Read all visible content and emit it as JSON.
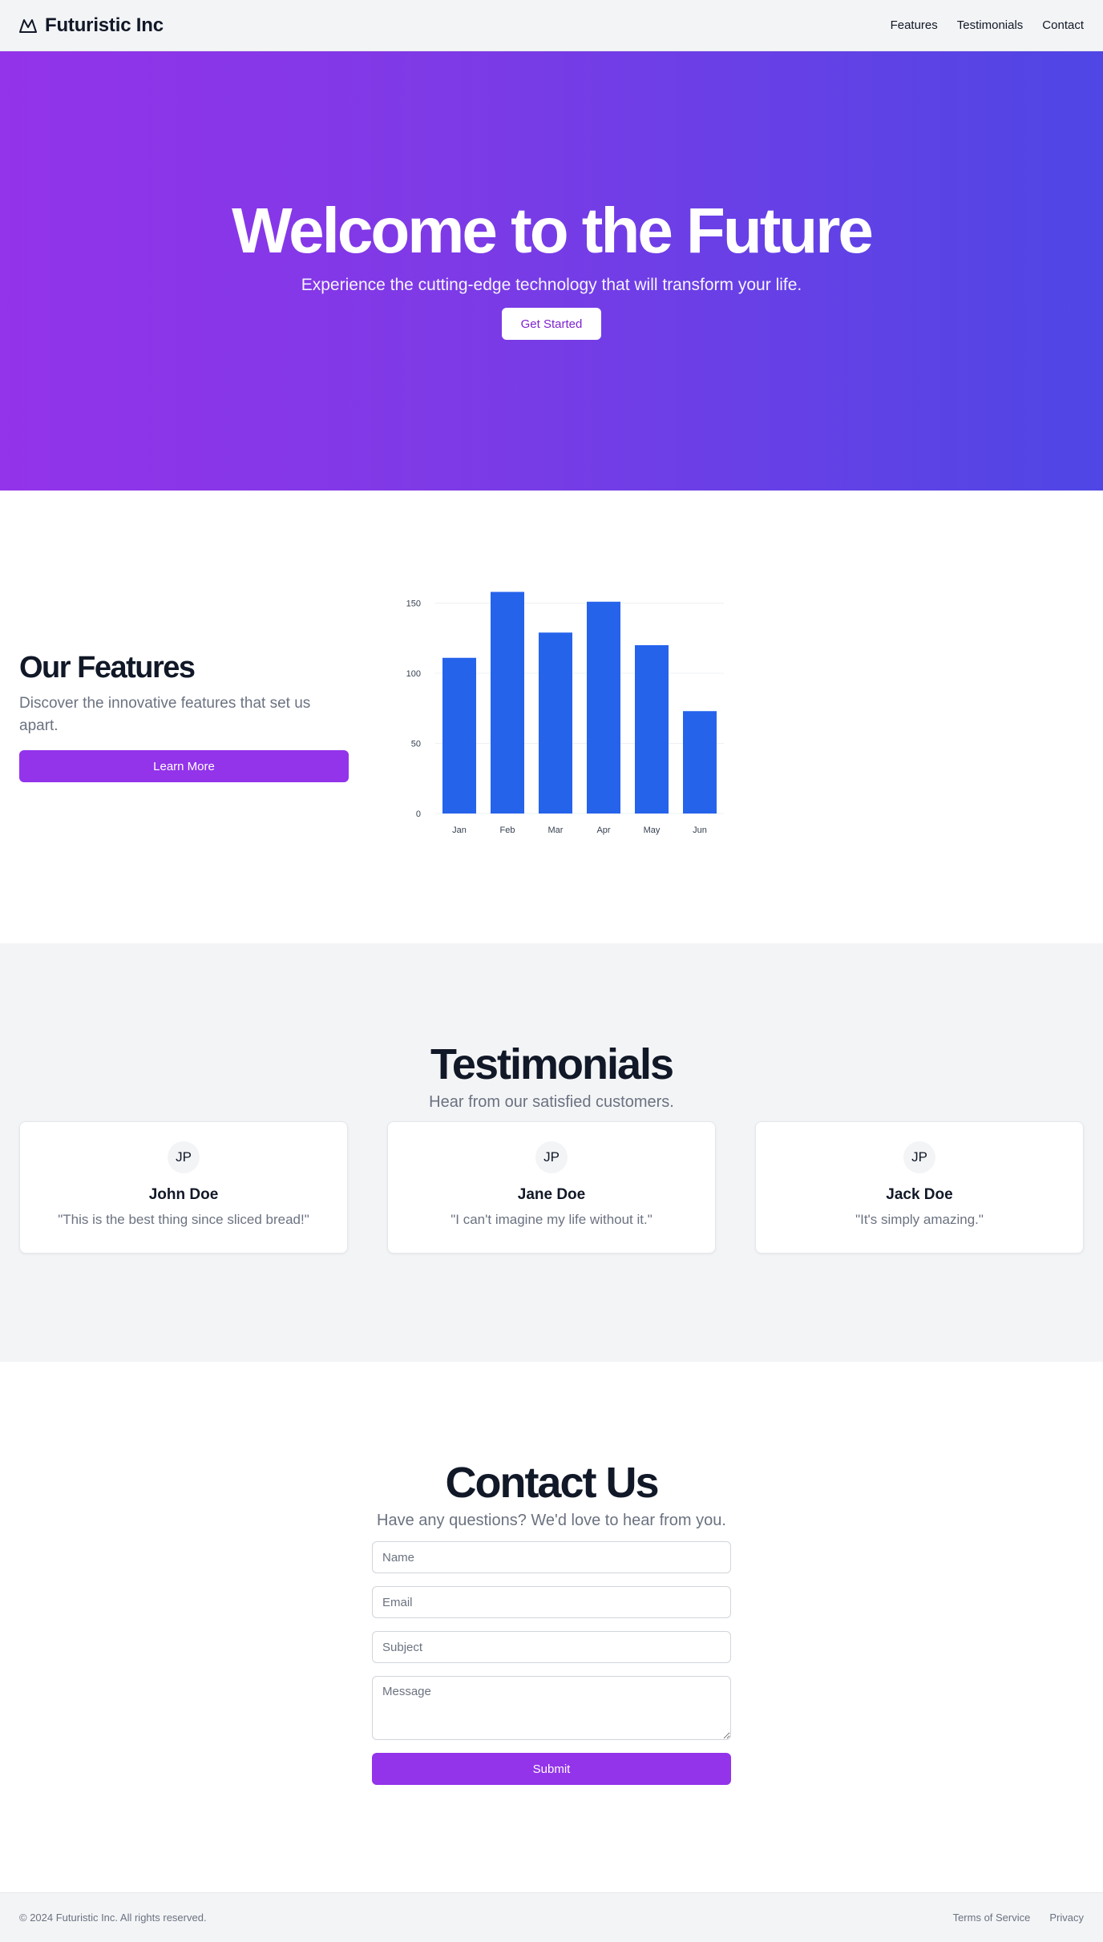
{
  "header": {
    "brand": "Futuristic Inc",
    "nav": [
      "Features",
      "Testimonials",
      "Contact"
    ]
  },
  "hero": {
    "title": "Welcome to the Future",
    "subtitle": "Experience the cutting-edge technology that will transform your life.",
    "cta": "Get Started"
  },
  "features": {
    "title": "Our Features",
    "text": "Discover the innovative features that set us apart.",
    "button": "Learn More"
  },
  "chart_data": {
    "type": "bar",
    "categories": [
      "Jan",
      "Feb",
      "Mar",
      "Apr",
      "May",
      "Jun"
    ],
    "values": [
      111,
      158,
      129,
      151,
      120,
      73
    ],
    "yticks": [
      0,
      50,
      100,
      150
    ],
    "ylim": [
      0,
      160
    ],
    "title": "",
    "xlabel": "",
    "ylabel": "",
    "grid": "horizontal",
    "bar_color": "#2563eb"
  },
  "testimonials": {
    "title": "Testimonials",
    "subtitle": "Hear from our satisfied customers.",
    "items": [
      {
        "initials": "JP",
        "name": "John Doe",
        "quote": "\"This is the best thing since sliced bread!\""
      },
      {
        "initials": "JP",
        "name": "Jane Doe",
        "quote": "\"I can't imagine my life without it.\""
      },
      {
        "initials": "JP",
        "name": "Jack Doe",
        "quote": "\"It's simply amazing.\""
      }
    ]
  },
  "contact": {
    "title": "Contact Us",
    "subtitle": "Have any questions? We'd love to hear from you.",
    "name_placeholder": "Name",
    "email_placeholder": "Email",
    "subject_placeholder": "Subject",
    "message_placeholder": "Message",
    "submit": "Submit"
  },
  "footer": {
    "copyright": "© 2024 Futuristic Inc. All rights reserved.",
    "links": [
      "Terms of Service",
      "Privacy"
    ]
  },
  "colors": {
    "accent": "#9333ea",
    "gradient_start": "#9333ea",
    "gradient_end": "#4f46e5",
    "chart_bar": "#2563eb"
  },
  "icons": {
    "brand": "mountain-icon"
  }
}
